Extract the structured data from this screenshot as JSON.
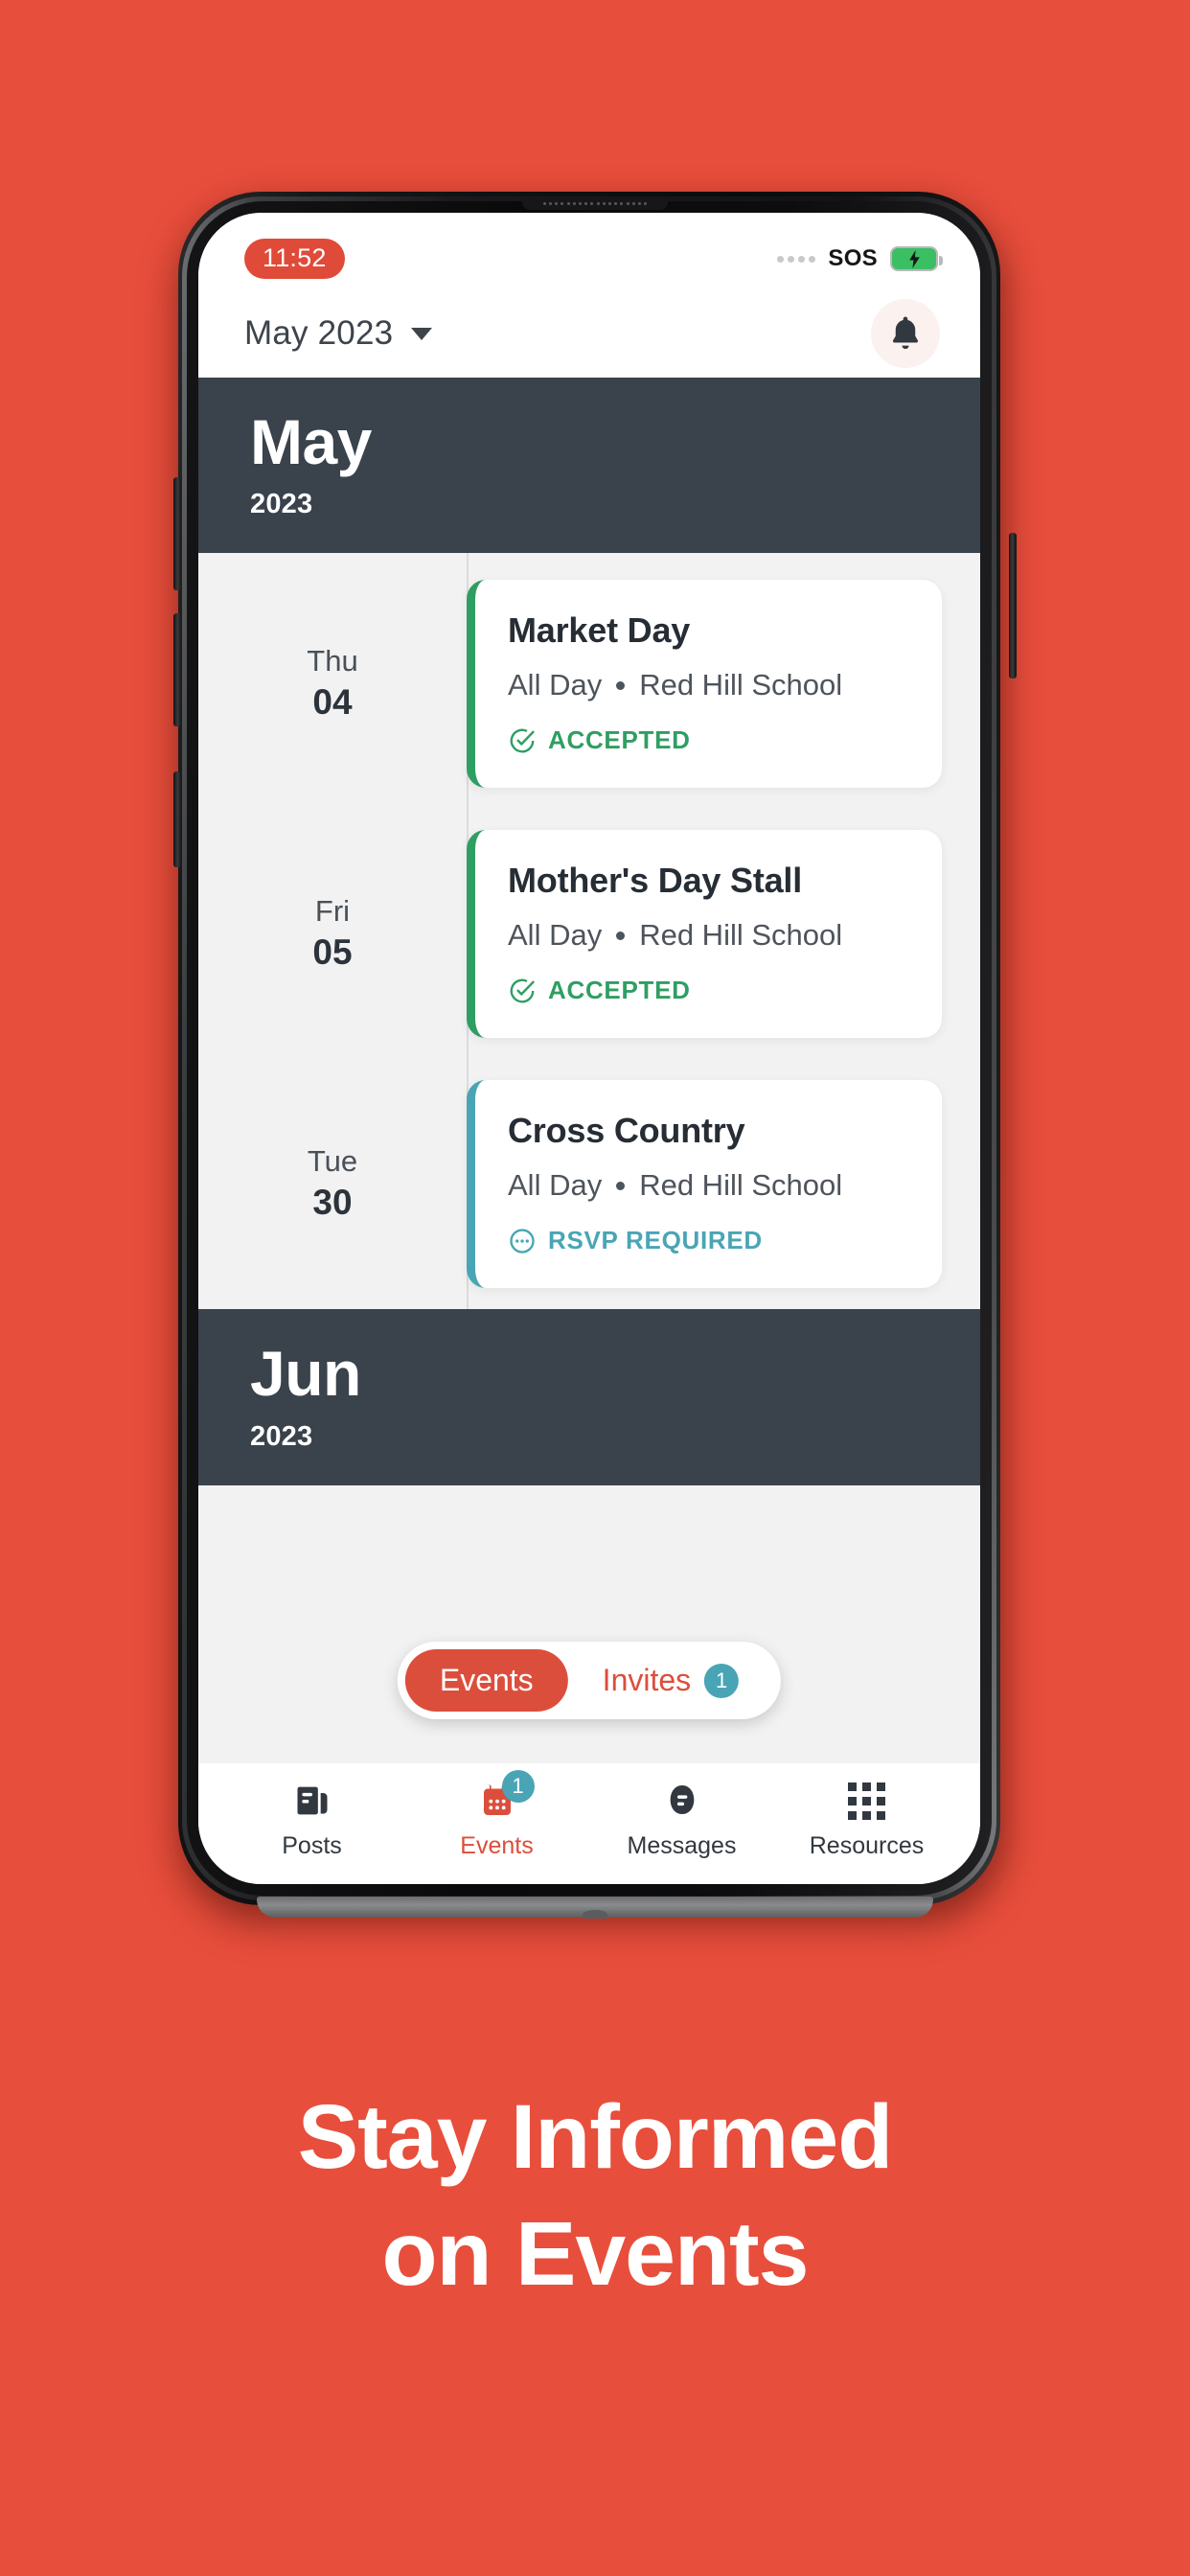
{
  "colors": {
    "background_red": "#e84e3c",
    "accent_red": "#dc4e3c",
    "dark_slate": "#3a424c",
    "green": "#2f9e63",
    "teal": "#49a5b5",
    "screen_grey": "#f2f2f2"
  },
  "status_bar": {
    "time": "11:52",
    "carrier": "SOS",
    "signal_icon": "signal-dots-icon",
    "battery_icon": "battery-charging-icon"
  },
  "appbar": {
    "month_label": "May 2023",
    "dropdown_icon": "chevron-down-icon",
    "notifications_icon": "bell-icon"
  },
  "month_banner": {
    "month": "May",
    "year": "2023"
  },
  "events": [
    {
      "dow": "Thu",
      "day": "04",
      "title": "Market Day",
      "time": "All Day",
      "location": "Red Hill School",
      "status_label": "ACCEPTED",
      "status_type": "accepted",
      "status_icon": "check-circle-icon"
    },
    {
      "dow": "Fri",
      "day": "05",
      "title": "Mother's Day Stall",
      "time": "All Day",
      "location": "Red Hill School",
      "status_label": "ACCEPTED",
      "status_type": "accepted",
      "status_icon": "check-circle-icon"
    },
    {
      "dow": "Tue",
      "day": "30",
      "title": "Cross Country",
      "time": "All Day",
      "location": "Red Hill School",
      "status_label": "RSVP REQUIRED",
      "status_type": "rsvp",
      "status_icon": "dots-circle-icon"
    }
  ],
  "next_month_banner": {
    "month": "Jun",
    "year": "2023"
  },
  "segmented_control": {
    "events_label": "Events",
    "invites_label": "Invites",
    "invites_badge": "1"
  },
  "bottom_nav": [
    {
      "label": "Posts",
      "icon": "posts-icon",
      "badge": "",
      "active": false
    },
    {
      "label": "Events",
      "icon": "calendar-icon",
      "badge": "1",
      "active": true
    },
    {
      "label": "Messages",
      "icon": "message-icon",
      "badge": "",
      "active": false
    },
    {
      "label": "Resources",
      "icon": "grid-icon",
      "badge": "",
      "active": false
    }
  ],
  "promo": {
    "headline_line1": "Stay Informed",
    "headline_line2": "on Events"
  }
}
